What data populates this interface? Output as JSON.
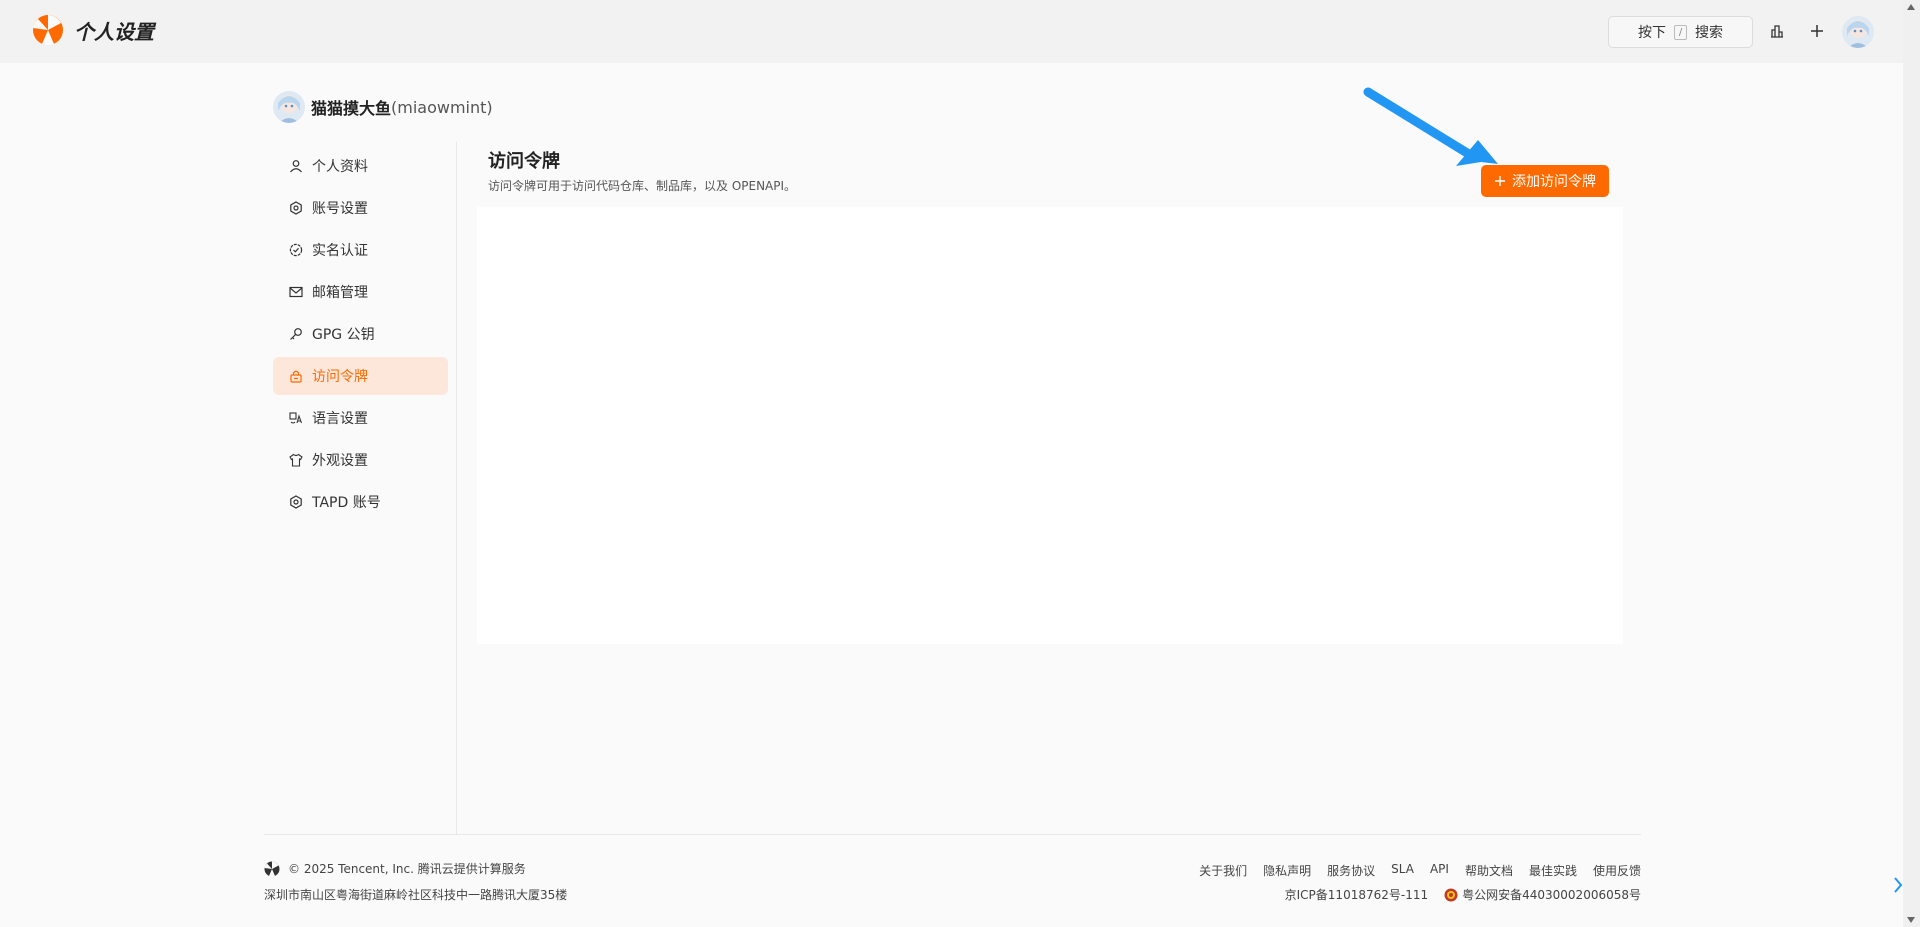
{
  "header": {
    "title": "个人设置",
    "search_press": "按下",
    "search_key": "/",
    "search_label": "搜索"
  },
  "user": {
    "name": "猫猫摸大鱼",
    "handle": "(miaowmint)"
  },
  "sidebar": {
    "items": [
      {
        "label": "个人资料",
        "icon": "user-icon"
      },
      {
        "label": "账号设置",
        "icon": "settings-icon"
      },
      {
        "label": "实名认证",
        "icon": "verified-icon"
      },
      {
        "label": "邮箱管理",
        "icon": "mail-icon"
      },
      {
        "label": "GPG 公钥",
        "icon": "key-icon"
      },
      {
        "label": "访问令牌",
        "icon": "lock-icon",
        "active": true
      },
      {
        "label": "语言设置",
        "icon": "translate-icon"
      },
      {
        "label": "外观设置",
        "icon": "shirt-icon"
      },
      {
        "label": "TAPD 账号",
        "icon": "settings-icon"
      }
    ]
  },
  "main": {
    "title": "访问令牌",
    "description": "访问令牌可用于访问代码仓库、制品库，以及 OPENAPI。",
    "add_button": "添加访问令牌"
  },
  "footer": {
    "copyright": "© 2025 Tencent, Inc. 腾讯云提供计算服务",
    "address": "深圳市南山区粤海街道麻岭社区科技中一路腾讯大厦35楼",
    "links": [
      "关于我们",
      "隐私声明",
      "服务协议",
      "SLA",
      "API",
      "帮助文档",
      "最佳实践",
      "使用反馈"
    ],
    "icp": "京ICP备11018762号-111",
    "police": "粤公网安备44030002006058号"
  },
  "colors": {
    "accent": "#ff6a00",
    "active_bg": "#fde7da",
    "arrow": "#2196f3"
  }
}
